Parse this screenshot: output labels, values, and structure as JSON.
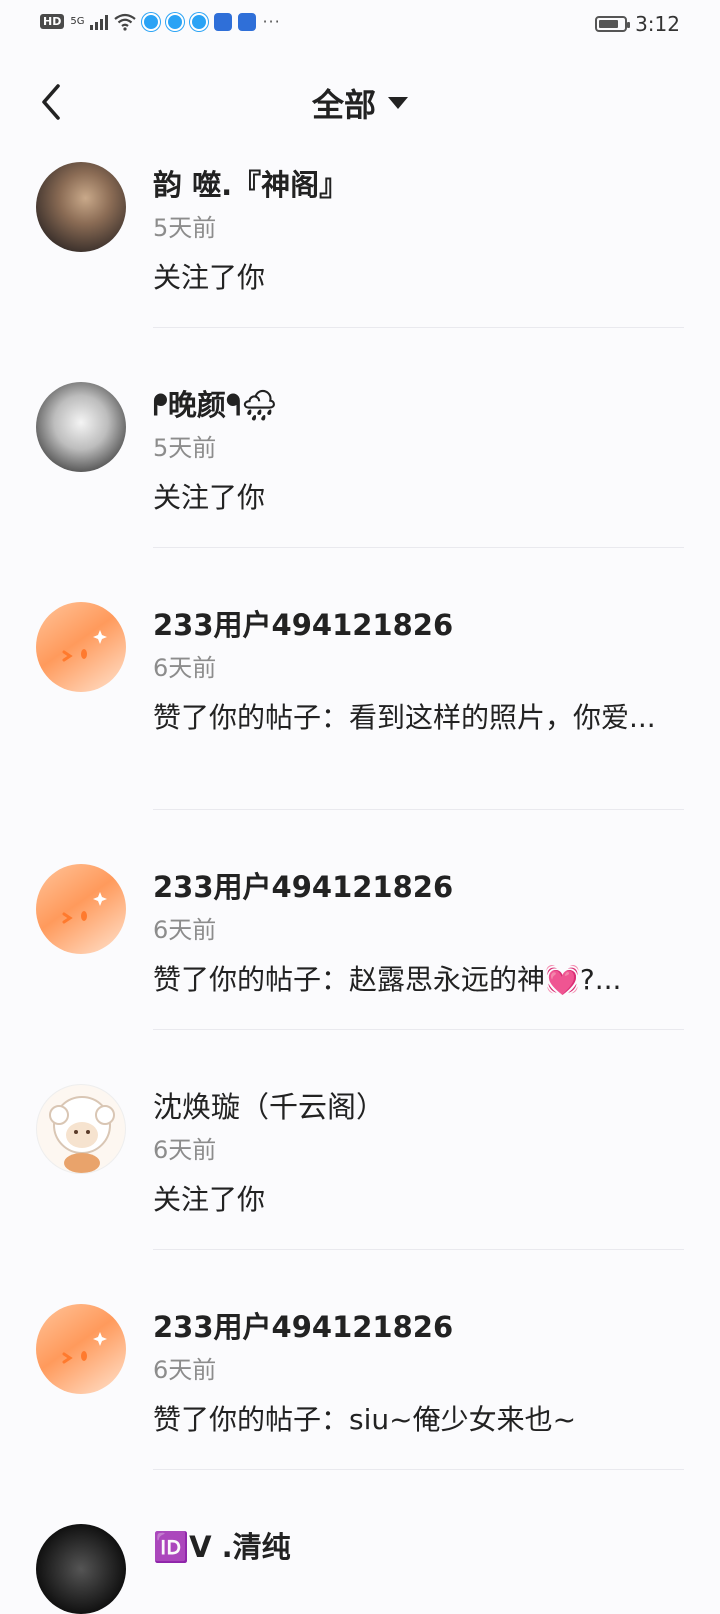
{
  "status_bar": {
    "network_badge": "HD",
    "network_type": "5G",
    "more": "···",
    "time": "3:12",
    "battery_level": 0.8
  },
  "header": {
    "title": "全部",
    "back_icon": "chevron-left-icon",
    "dropdown_icon": "caret-down-icon"
  },
  "notifications": [
    {
      "name": "韵  噬.『神阁』",
      "time": "5天前",
      "message": "关注了你",
      "avatar": "photo-cat"
    },
    {
      "name": "ᖰ晚颜ᖳ🌧",
      "time": "5天前",
      "message": "关注了你",
      "avatar": "photo-doll"
    },
    {
      "name": "233用户494121826",
      "time": "6天前",
      "message": "赞了你的帖子：看到这样的照片，你爱...",
      "avatar": "default-orange"
    },
    {
      "name": "233用户494121826",
      "time": "6天前",
      "message": "赞了你的帖子：赵露思永远的神💓?...",
      "avatar": "default-orange"
    },
    {
      "name": "沈焕璇（千云阁）",
      "time": "6天前",
      "message": "关注了你",
      "avatar": "sheep"
    },
    {
      "name": "233用户494121826",
      "time": "6天前",
      "message": "赞了你的帖子：siu~俺少女来也~",
      "avatar": "default-orange"
    },
    {
      "name": "🆔V .清纯",
      "time": "",
      "message": "",
      "avatar": "photo-dark"
    }
  ]
}
